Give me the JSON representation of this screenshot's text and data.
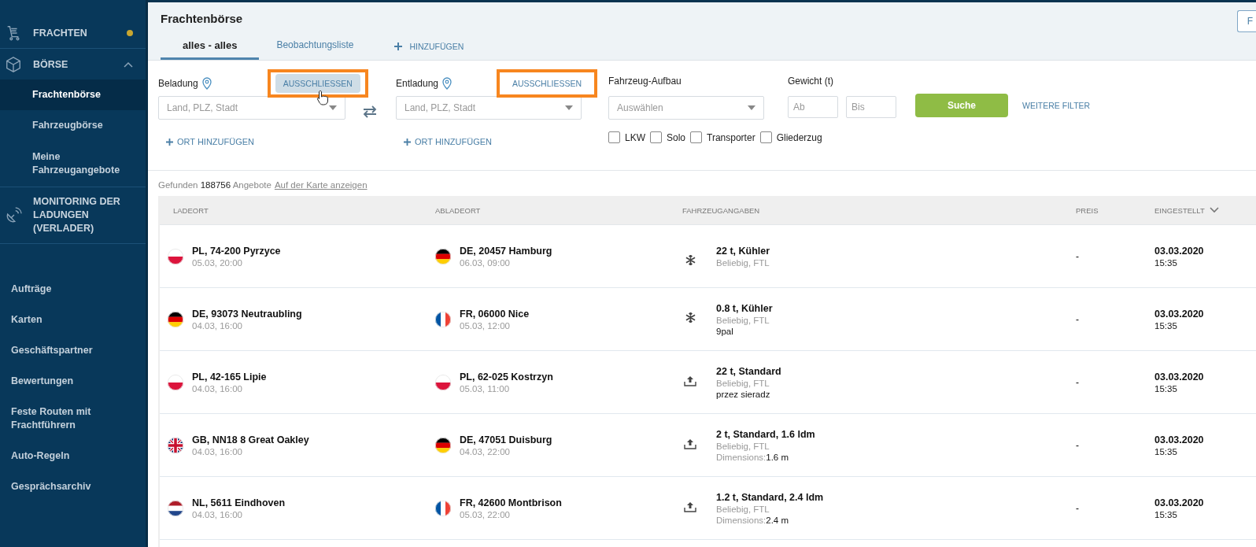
{
  "sidebar": {
    "sections": [
      {
        "label": "FRACHTEN",
        "color": "#c8a630"
      },
      {
        "label": "BÖRSE",
        "expanded": true,
        "children": [
          {
            "label": "Frachtenbörse",
            "selected": true
          },
          {
            "label": "Fahrzeugbörse",
            "selected": false
          },
          {
            "label": "Meine Fahrzeugangebote",
            "selected": false
          }
        ]
      },
      {
        "label": "MONITORING DER LADUNGEN (VERLADER)"
      }
    ],
    "items": [
      "Aufträge",
      "Karten",
      "Geschäftspartner",
      "Bewertungen",
      "Feste Routen mit Frachtführern",
      "Auto-Regeln",
      "Gesprächsarchiv"
    ]
  },
  "page": {
    "title": "Frachtenbörse",
    "corner_button": "F"
  },
  "tabs": [
    {
      "label": "alles - alles",
      "selected": true
    },
    {
      "label": "Beobachtungsliste",
      "selected": false
    }
  ],
  "add_tab": "HINZUFÜGEN",
  "filters": {
    "loading": {
      "label": "Beladung",
      "placeholder": "Land, PLZ, Stadt",
      "exclude": "AUSSCHLIESSEN",
      "exclude_hover": true,
      "add": "ORT HINZUFÜGEN"
    },
    "unloading": {
      "label": "Entladung",
      "placeholder": "Land, PLZ, Stadt",
      "exclude": "AUSSCHLIESSEN",
      "exclude_hover": false,
      "add": "ORT HINZUFÜGEN"
    },
    "body": {
      "label": "Fahrzeug-Aufbau",
      "placeholder": "Auswählen"
    },
    "weight": {
      "label": "Gewicht (t)",
      "from": {
        "placeholder": "Ab"
      },
      "to": {
        "placeholder": "Bis"
      }
    },
    "search": "Suche",
    "more": "WEITERE FILTER",
    "vehicle_types": [
      {
        "label": "LKW",
        "checked": false
      },
      {
        "label": "Solo",
        "checked": false
      },
      {
        "label": "Transporter",
        "checked": false
      },
      {
        "label": "Gliederzug",
        "checked": false
      }
    ]
  },
  "results": {
    "prefix": "Gefunden",
    "count": "188756",
    "suffix": "Angebote",
    "map_link": "Auf der Karte anzeigen"
  },
  "table": {
    "columns": [
      "LADEORT",
      "ABLADEORT",
      "FAHRZEUGANGABEN",
      "PREIS",
      "EINGESTELLT"
    ],
    "rows": [
      {
        "load": {
          "kind": "pl",
          "place": "PL, 74-200 Pyrzyce",
          "time": "05.03, 20:00"
        },
        "unload": {
          "kind": "de",
          "place": "DE, 20457 Hamburg",
          "time": "06.03, 09:00"
        },
        "vehicle": {
          "kind": "reefer",
          "title": "22 t, Kühler",
          "sub": "Beliebig, FTL"
        },
        "price": "-",
        "date": "03.03.2020",
        "time": "15:35"
      },
      {
        "load": {
          "kind": "de",
          "place": "DE, 93073 Neutraubling",
          "time": "04.03, 16:00"
        },
        "unload": {
          "kind": "fr",
          "place": "FR, 06000 Nice",
          "time": "05.03, 12:00"
        },
        "vehicle": {
          "kind": "reefer",
          "title": "0.8 t, Kühler",
          "sub": "Beliebig, FTL",
          "note": "9pal"
        },
        "price": "-",
        "date": "03.03.2020",
        "time": "15:35"
      },
      {
        "load": {
          "kind": "pl",
          "place": "PL, 42-165 Lipie",
          "time": "04.03, 16:00"
        },
        "unload": {
          "kind": "pl",
          "place": "PL, 62-025 Kostrzyn",
          "time": "05.03, 11:00"
        },
        "vehicle": {
          "kind": "standard",
          "title": "22 t, Standard",
          "sub": "Beliebig, FTL",
          "note": "przez sieradz"
        },
        "price": "-",
        "date": "03.03.2020",
        "time": "15:35"
      },
      {
        "load": {
          "kind": "gb",
          "place": "GB, NN18 8 Great Oakley",
          "time": "04.03, 16:00"
        },
        "unload": {
          "kind": "de",
          "place": "DE, 47051 Duisburg",
          "time": "04.03, 22:00"
        },
        "vehicle": {
          "kind": "standard",
          "title": "2 t, Standard, 1.6 ldm",
          "sub": "Beliebig, FTL",
          "note_label": "Dimensions:",
          "note": "1.6 m"
        },
        "price": "-",
        "date": "03.03.2020",
        "time": "15:35"
      },
      {
        "load": {
          "kind": "nl",
          "place": "NL, 5611 Eindhoven",
          "time": "04.03, 16:00"
        },
        "unload": {
          "kind": "fr",
          "place": "FR, 42600 Montbrison",
          "time": "05.03, 22:00"
        },
        "vehicle": {
          "kind": "standard",
          "title": "1.2 t, Standard, 2.4 ldm",
          "sub": "Beliebig, FTL",
          "note_label": "Dimensions:",
          "note": "2.4 m"
        },
        "price": "-",
        "date": "03.03.2020",
        "time": "15:35"
      }
    ]
  }
}
